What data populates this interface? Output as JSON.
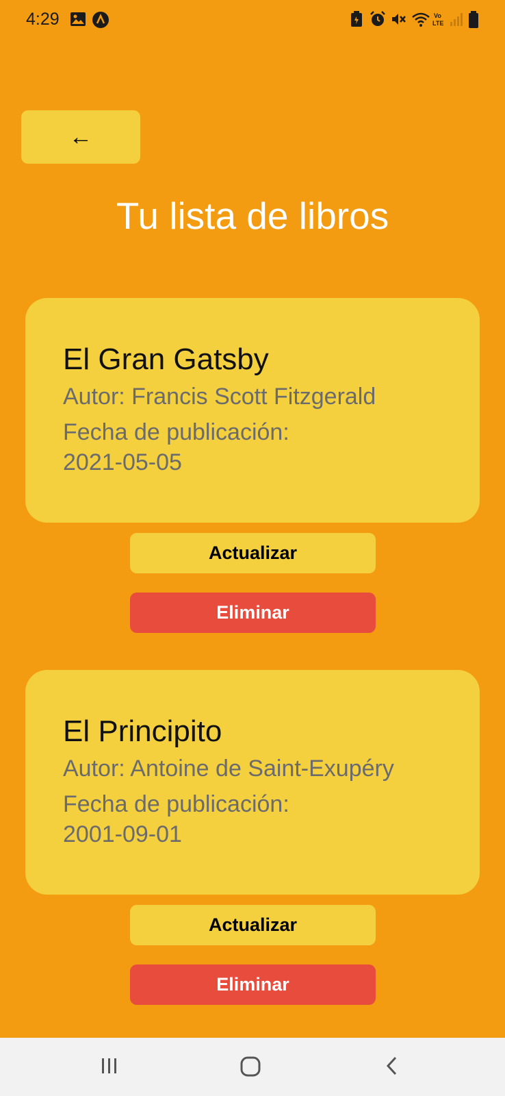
{
  "status_bar": {
    "time": "4:29",
    "icons": [
      "gallery-icon",
      "app-notification-icon",
      "battery-saver-icon",
      "alarm-icon",
      "mute-icon",
      "wifi-icon",
      "volte-icon",
      "signal-icon",
      "battery-icon"
    ],
    "volte_label": "Vo LTE"
  },
  "header": {
    "back_label": "←",
    "title": "Tu lista de libros"
  },
  "books": [
    {
      "title": "El Gran Gatsby",
      "author": "Autor: Francis Scott Fitzgerald",
      "date_label": "Fecha de publicación:",
      "date": "2021-05-05",
      "update_label": "Actualizar",
      "delete_label": "Eliminar"
    },
    {
      "title": "El Principito",
      "author": "Autor: Antoine de Saint-Exupéry",
      "date_label": "Fecha de publicación:",
      "date": "2001-09-01",
      "update_label": "Actualizar",
      "delete_label": "Eliminar"
    }
  ],
  "nav_bar": {
    "items": [
      "recent-apps-icon",
      "home-icon",
      "back-nav-icon"
    ]
  },
  "colors": {
    "background": "#F39C12",
    "card": "#F4D03F",
    "delete": "#E74C3C",
    "title_text": "#FFFFFF"
  }
}
